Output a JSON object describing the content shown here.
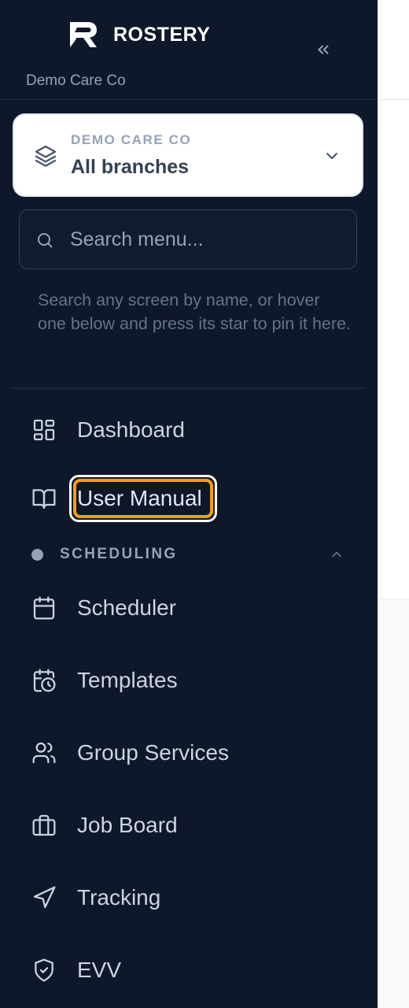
{
  "brand": {
    "name": "ROSTERY",
    "org_subtitle": "Demo Care Co"
  },
  "branch_selector": {
    "org_label": "DEMO CARE CO",
    "selected_branch": "All branches"
  },
  "search": {
    "placeholder": "Search menu...",
    "value": "",
    "help_text": "Search any screen by name, or hover one below and press its star to pin it here."
  },
  "nav": {
    "dashboard": {
      "label": "Dashboard",
      "icon": "dashboard-grid-icon"
    },
    "user_manual": {
      "label": "User Manual",
      "icon": "book-open-icon"
    }
  },
  "sections": {
    "scheduling": {
      "title": "SCHEDULING",
      "expanded": true,
      "items": [
        {
          "label": "Scheduler",
          "icon": "calendar-icon"
        },
        {
          "label": "Templates",
          "icon": "calendar-clock-icon"
        },
        {
          "label": "Group Services",
          "icon": "users-icon"
        },
        {
          "label": "Job Board",
          "icon": "briefcase-icon"
        },
        {
          "label": "Tracking",
          "icon": "navigation-icon"
        },
        {
          "label": "EVV",
          "icon": "shield-check-icon"
        }
      ]
    }
  },
  "colors": {
    "sidebar_bg": "#0f172a",
    "focus_ring": "#f59e0b",
    "text_primary": "#cbd5e1",
    "text_muted": "#94a3b8"
  }
}
